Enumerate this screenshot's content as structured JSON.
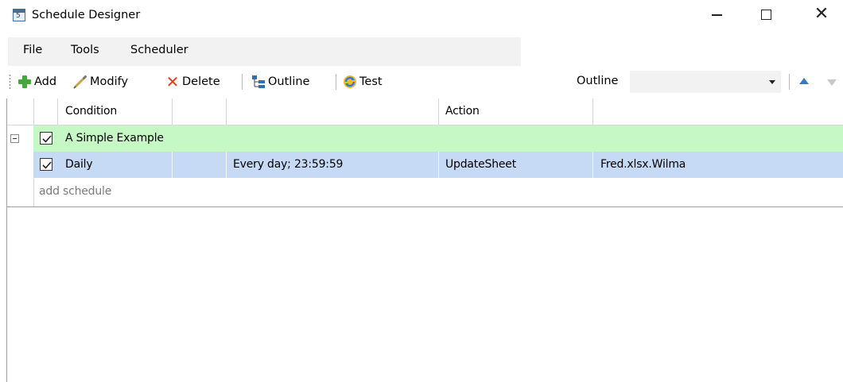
{
  "window": {
    "title": "Schedule Designer",
    "icon_name": "calendar-icon",
    "icon_glyph": "5"
  },
  "menu": {
    "file": "File",
    "tools": "Tools",
    "scheduler": "Scheduler"
  },
  "toolbar": {
    "add": "Add",
    "modify": "Modify",
    "delete": "Delete",
    "outline": "Outline",
    "test": "Test",
    "view_select": "Outline"
  },
  "grid": {
    "columns": [
      "Condition",
      "",
      "Action",
      ""
    ],
    "group": {
      "name": "A Simple Example",
      "checked": true,
      "color": "#c5f8c5"
    },
    "rows": [
      {
        "checked": true,
        "name": "Daily",
        "condition": "Every day; 23:59:59",
        "action": "UpdateSheet",
        "target": "Fred.xlsx.Wilma",
        "color": "#c6daf5"
      }
    ],
    "add_placeholder": "add schedule"
  },
  "colors": {
    "accent": "#3a78c4",
    "add_green": "#46a83c",
    "delete_red": "#e0401e"
  }
}
